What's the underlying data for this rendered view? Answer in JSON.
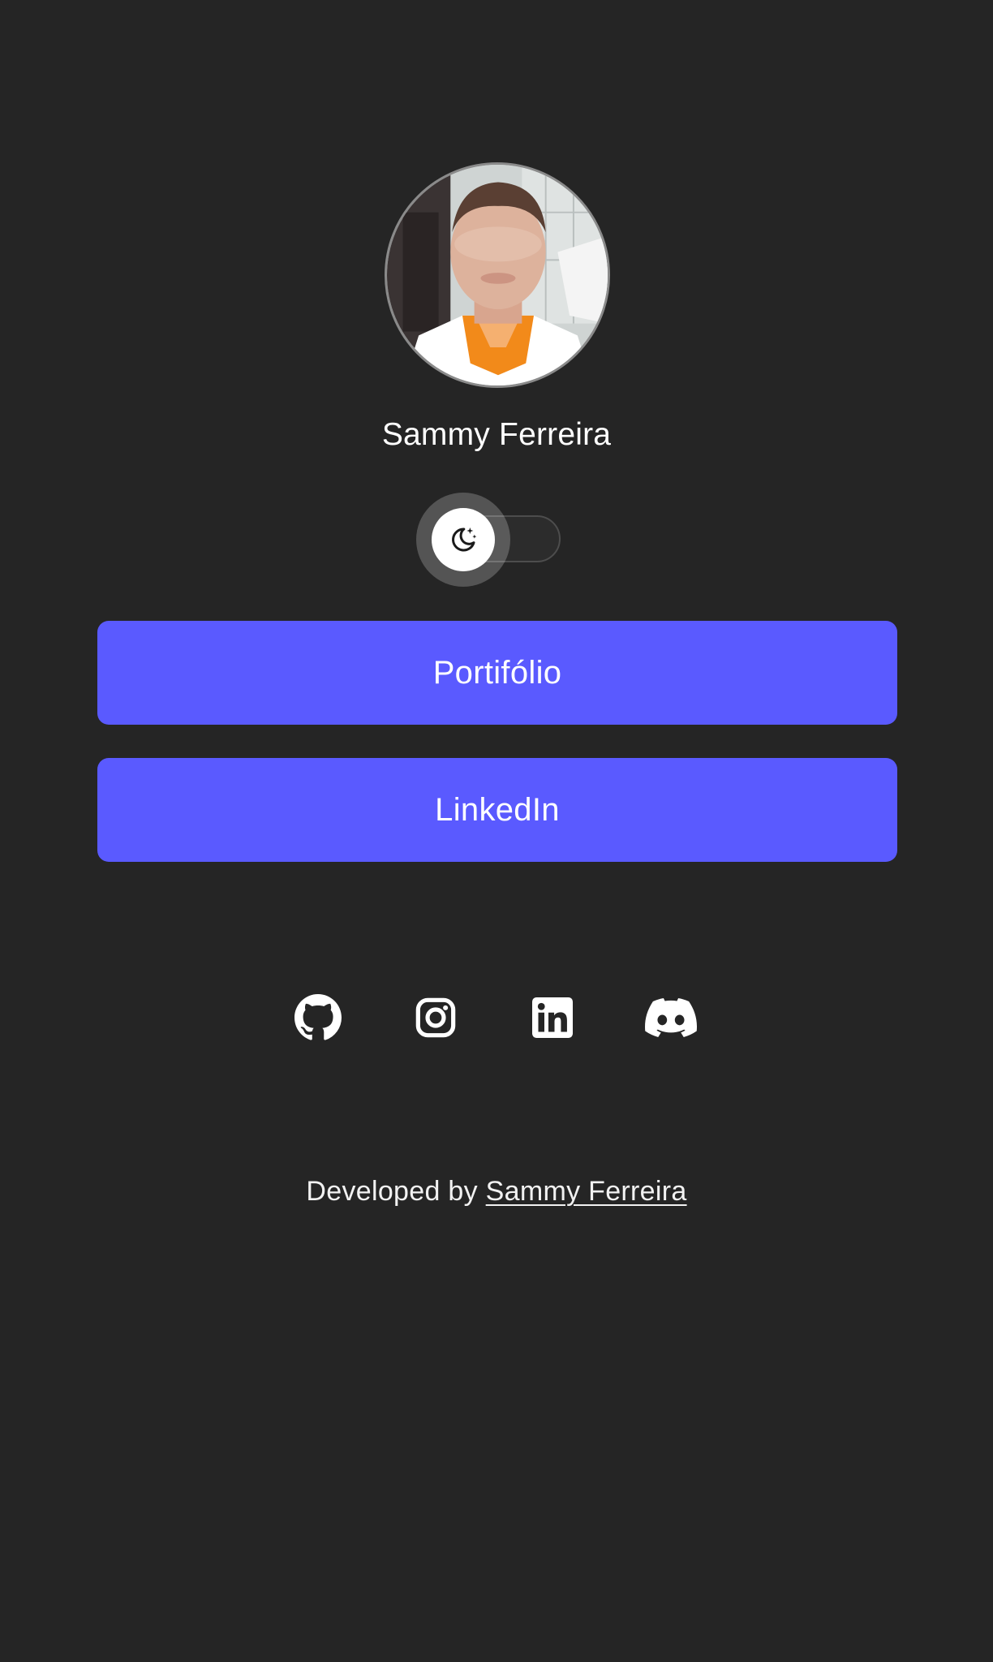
{
  "profile": {
    "name": "Sammy Ferreira"
  },
  "theme_toggle": {
    "icon": "moon-stars-icon",
    "state": "dark"
  },
  "links": [
    {
      "label": "Portifólio"
    },
    {
      "label": "LinkedIn"
    }
  ],
  "socials": [
    {
      "icon": "github-icon"
    },
    {
      "icon": "instagram-icon"
    },
    {
      "icon": "linkedin-icon"
    },
    {
      "icon": "discord-icon"
    }
  ],
  "footer": {
    "prefix": "Developed by ",
    "author": "Sammy Ferreira"
  },
  "colors": {
    "background": "#252525",
    "button": "#5a5aff",
    "text": "#ffffff"
  }
}
